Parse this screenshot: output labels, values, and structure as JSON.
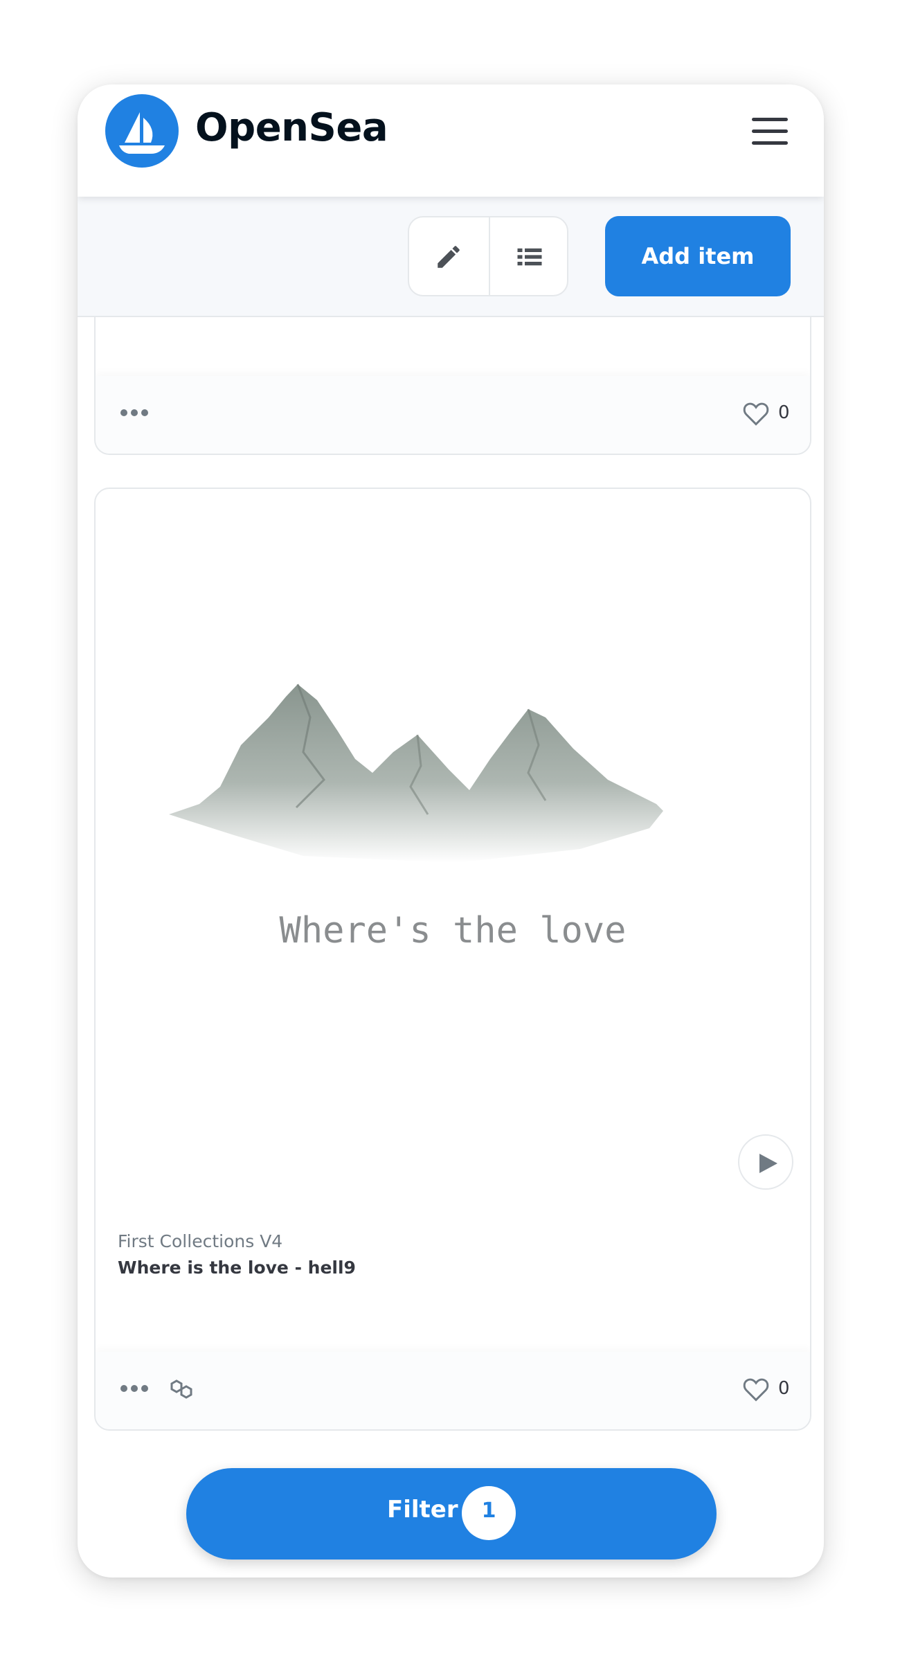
{
  "header": {
    "brand": "OpenSea",
    "logo_icon": "opensea-ship-logo",
    "menu_icon": "hamburger-menu-icon"
  },
  "toolbar": {
    "edit_icon": "pencil-icon",
    "list_icon": "list-view-icon",
    "add_item_label": "Add item"
  },
  "cards": [
    {
      "favorites_count": "0"
    },
    {
      "image_caption": "Where's the love",
      "collection": "First Collections V4",
      "name": "Where is the love - hell9",
      "favorites_count": "0",
      "chain_icon": "polygon-chain-icon"
    }
  ],
  "filter": {
    "label": "Filter",
    "count": "1"
  },
  "colors": {
    "accent": "#2081e2",
    "text_dark": "#04111d",
    "text_muted": "#707a83",
    "border": "#e5e8eb"
  }
}
